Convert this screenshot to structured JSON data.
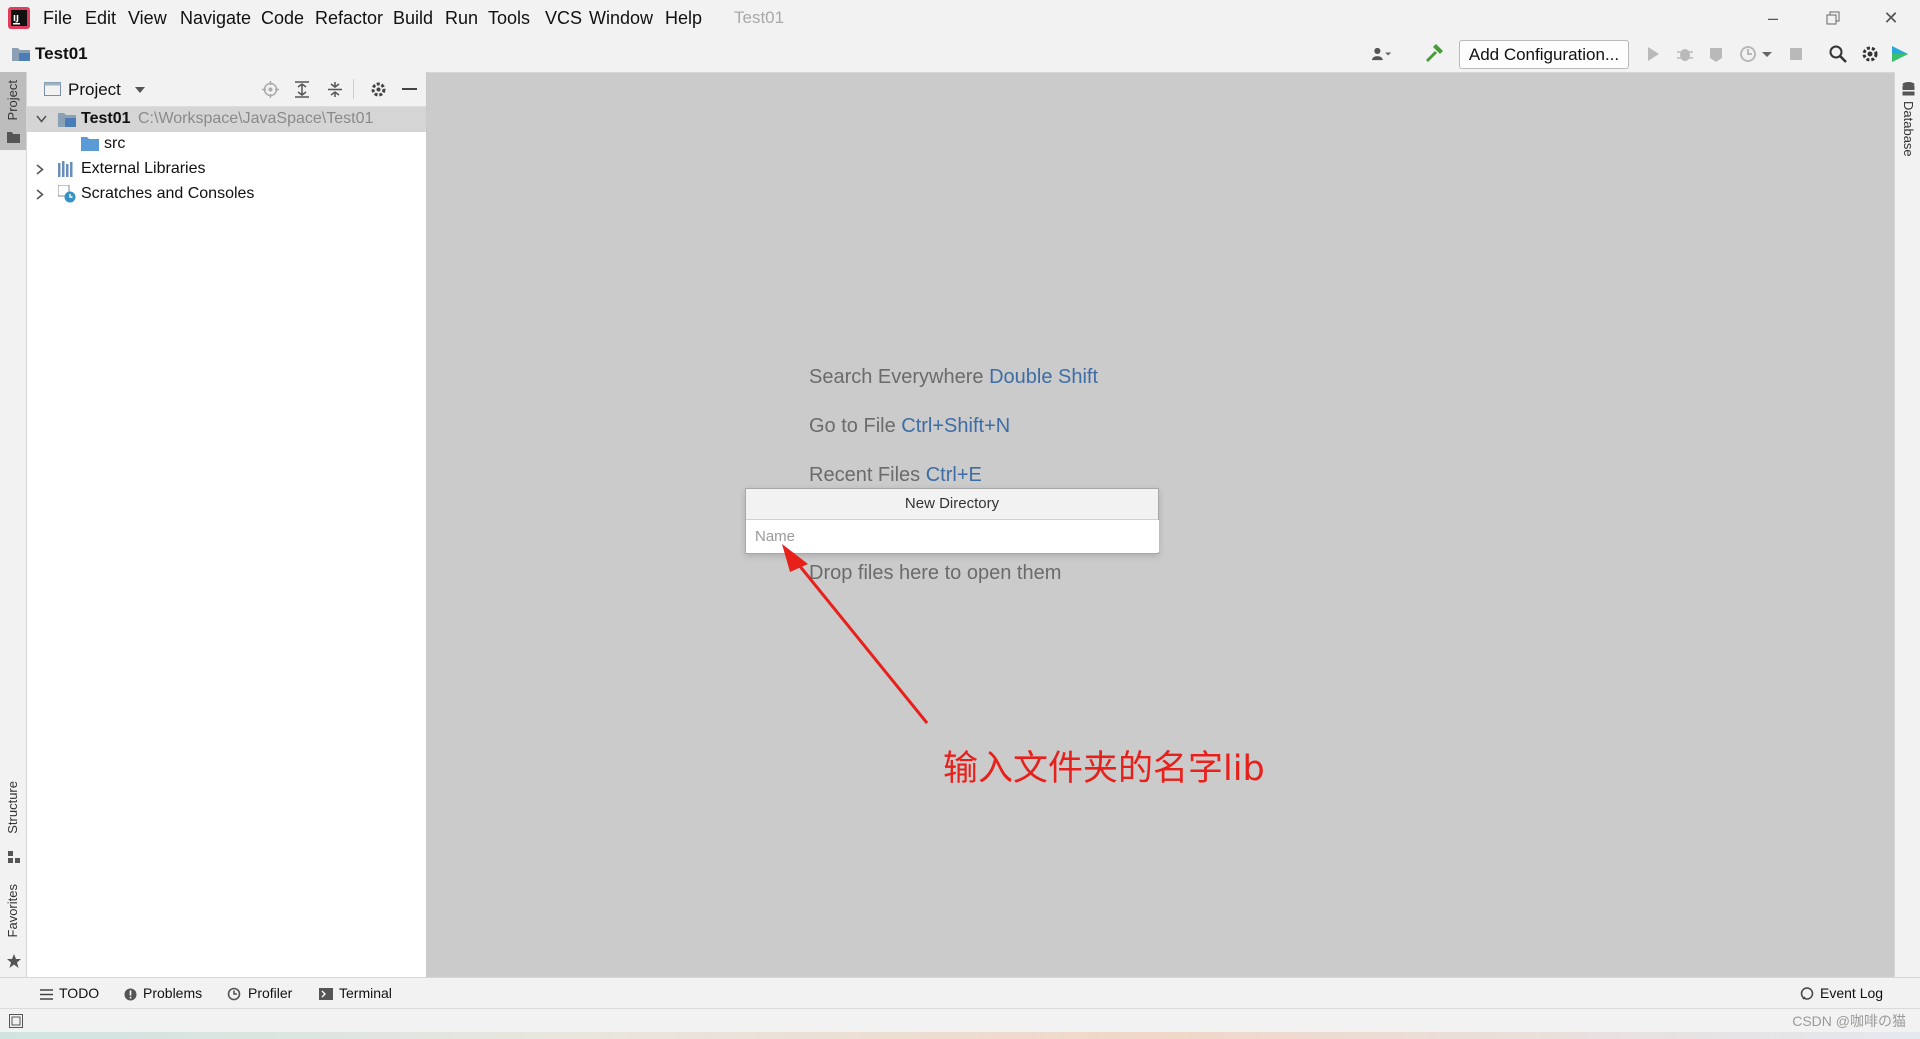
{
  "menu": {
    "items": [
      "File",
      "Edit",
      "View",
      "Navigate",
      "Code",
      "Refactor",
      "Build",
      "Run",
      "Tools",
      "VCS",
      "Window",
      "Help"
    ],
    "window_title": "Test01"
  },
  "navbar": {
    "project_name": "Test01",
    "add_configuration": "Add Configuration..."
  },
  "left_stripe": {
    "project_tab": "Project",
    "structure_tab": "Structure",
    "favorites_tab": "Favorites"
  },
  "right_stripe": {
    "database_tab": "Database"
  },
  "project_panel": {
    "title": "Project",
    "tree": [
      {
        "label": "Test01",
        "path": "C:\\Workspace\\JavaSpace\\Test01"
      },
      {
        "label": "src"
      },
      {
        "label": "External Libraries"
      },
      {
        "label": "Scratches and Consoles"
      }
    ]
  },
  "editor_hints": [
    {
      "text": "Search Everywhere",
      "key": "Double Shift"
    },
    {
      "text": "Go to File",
      "key": "Ctrl+Shift+N"
    },
    {
      "text": "Recent Files",
      "key": "Ctrl+E"
    },
    {
      "text": "Drop files here to open them",
      "key": ""
    }
  ],
  "new_directory_popup": {
    "title": "New Directory",
    "placeholder": "Name"
  },
  "annotation": {
    "text": "输入文件夹的名字lib",
    "color": "#e8201b"
  },
  "bottom_tabs": {
    "todo": "TODO",
    "problems": "Problems",
    "profiler": "Profiler",
    "terminal": "Terminal",
    "event_log": "Event Log"
  },
  "watermark": "CSDN @咖啡の猫",
  "colors": {
    "accent_key": "#3e6da6",
    "annotation_red": "#e8201b",
    "build_green": "#4a9b3a"
  }
}
